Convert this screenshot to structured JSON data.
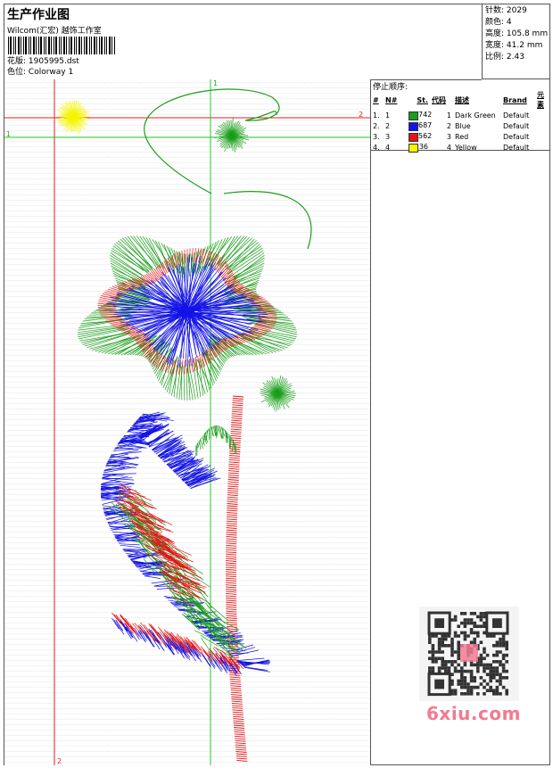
{
  "header": {
    "title": "生产作业图",
    "company": "Wilcom(汇宏) 越饰工作室",
    "design_label": "花版:",
    "design_file": "1905995.dst",
    "colorway_label": "色位:",
    "colorway": "Colorway 1"
  },
  "stats": [
    {
      "label": "针数:",
      "value": "2029"
    },
    {
      "label": "颜色:",
      "value": "4"
    },
    {
      "label": "高度:",
      "value": "105.8 mm"
    },
    {
      "label": "宽度:",
      "value": "41.2 mm"
    },
    {
      "label": "比例:",
      "value": "2.43"
    }
  ],
  "stop_sequence": {
    "title": "停止顺序:",
    "headers": [
      "#",
      "N#",
      "St.",
      "代码",
      "描述",
      "Brand",
      "元素"
    ],
    "rows": [
      {
        "num": "1.",
        "n": "1",
        "color": "#1a9e1a",
        "st": "742",
        "code": "1",
        "desc": "Dark Green",
        "brand": "Default"
      },
      {
        "num": "2.",
        "n": "2",
        "color": "#1414e6",
        "st": "687",
        "code": "2",
        "desc": "Blue",
        "brand": "Default"
      },
      {
        "num": "3.",
        "n": "3",
        "color": "#e61414",
        "st": "562",
        "code": "3",
        "desc": "Red",
        "brand": "Default"
      },
      {
        "num": "4.",
        "n": "4",
        "color": "#f5f500",
        "st": "36",
        "code": "4",
        "desc": "Yellow",
        "brand": "Default"
      }
    ]
  },
  "guides": {
    "marker_1": "1",
    "marker_2": "2"
  },
  "watermark": "6xiu.com",
  "colors": {
    "green": "#1a9e1a",
    "blue": "#1414e6",
    "red": "#e61414",
    "yellow": "#f5f500",
    "guide_green": "#22cc22",
    "guide_red": "#dd2222",
    "brand_pink": "#f27a92"
  }
}
